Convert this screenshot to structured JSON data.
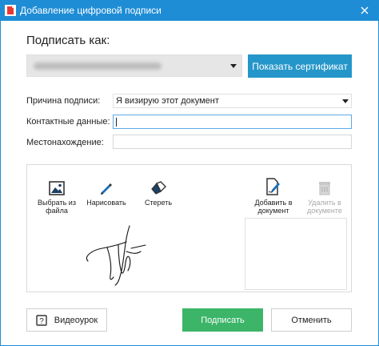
{
  "window": {
    "title": "Добавление цифровой подписи"
  },
  "sign_as": {
    "label": "Подписать как:",
    "show_cert_label": "Показать сертификат"
  },
  "fields": {
    "reason_label": "Причина подписи:",
    "reason_value": "Я визирую этот документ",
    "contact_label": "Контактные данные:",
    "contact_value": "",
    "location_label": "Местонахождение:",
    "location_value": ""
  },
  "tools": {
    "choose_file": "Выбрать из файла",
    "draw": "Нарисовать",
    "erase": "Стереть",
    "add_to_doc": "Добавить в документ",
    "remove_from_doc": "Удалить в документе"
  },
  "buttons": {
    "video": "Видеоурок",
    "sign": "Подписать",
    "cancel": "Отменить"
  },
  "colors": {
    "titlebar": "#1f8dd6",
    "accent_button": "#2596c9",
    "sign_button": "#3cb568"
  },
  "icons": [
    "app-icon",
    "close-icon",
    "dropdown-arrow-icon",
    "picture-icon",
    "pen-icon",
    "eraser-icon",
    "document-sign-icon",
    "trash-icon",
    "help-icon"
  ]
}
